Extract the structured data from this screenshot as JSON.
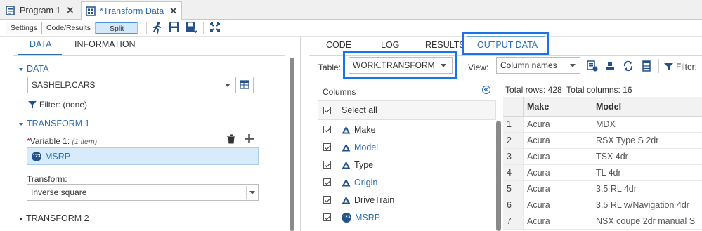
{
  "tabs": [
    {
      "label": "Program 1",
      "icon": "program-icon"
    },
    {
      "label": "*Transform Data",
      "icon": "task-icon"
    }
  ],
  "toolbar": {
    "layout_buttons": [
      "Settings",
      "Code/Results",
      "Split"
    ],
    "active_layout": "Split",
    "icons": [
      "run-icon",
      "save-icon",
      "save-as-icon",
      "expand-icon"
    ]
  },
  "left": {
    "tabs": [
      "DATA",
      "INFORMATION"
    ],
    "active_tab": "DATA",
    "data_section": "DATA",
    "dataset_value": "SASHELP.CARS",
    "filter_text": "Filter: (none)",
    "transform1_section": "TRANSFORM 1",
    "variable_required": "*",
    "variable_label": "Variable 1:",
    "variable_count": "(1 item)",
    "variable_value": "MSRP",
    "transform_label": "Transform:",
    "transform_value": "Inverse square",
    "transform2_section": "TRANSFORM 2"
  },
  "right": {
    "tabs": [
      "CODE",
      "LOG",
      "RESULTS",
      "OUTPUT DATA"
    ],
    "active_tab": "OUTPUT DATA",
    "table_label": "Table:",
    "table_value": "WORK.TRANSFORM",
    "view_label": "View:",
    "view_value": "Column names",
    "filter_label": "Filter:",
    "columns_header": "Columns",
    "select_all": "Select all",
    "columns": [
      {
        "name": "Make",
        "type": "char",
        "link": false
      },
      {
        "name": "Model",
        "type": "char",
        "link": true
      },
      {
        "name": "Type",
        "type": "char",
        "link": false
      },
      {
        "name": "Origin",
        "type": "char",
        "link": true
      },
      {
        "name": "DriveTrain",
        "type": "char",
        "link": false
      },
      {
        "name": "MSRP",
        "type": "num",
        "link": true
      }
    ],
    "totals": "Total rows: 428  Total columns: 16",
    "grid": {
      "headers": [
        "",
        "Make",
        "Model"
      ],
      "rows": [
        [
          "1",
          "Acura",
          "MDX"
        ],
        [
          "2",
          "Acura",
          "RSX Type S 2dr"
        ],
        [
          "3",
          "Acura",
          "TSX 4dr"
        ],
        [
          "4",
          "Acura",
          "TL 4dr"
        ],
        [
          "5",
          "Acura",
          "3.5 RL 4dr"
        ],
        [
          "6",
          "Acura",
          "3.5 RL w/Navigation 4dr"
        ],
        [
          "7",
          "Acura",
          "NSX coupe 2dr manual S"
        ]
      ]
    }
  },
  "colors": {
    "accent": "#2b6fb0",
    "highlight": "#1a73e8",
    "numeric_badge": "#25518a"
  }
}
